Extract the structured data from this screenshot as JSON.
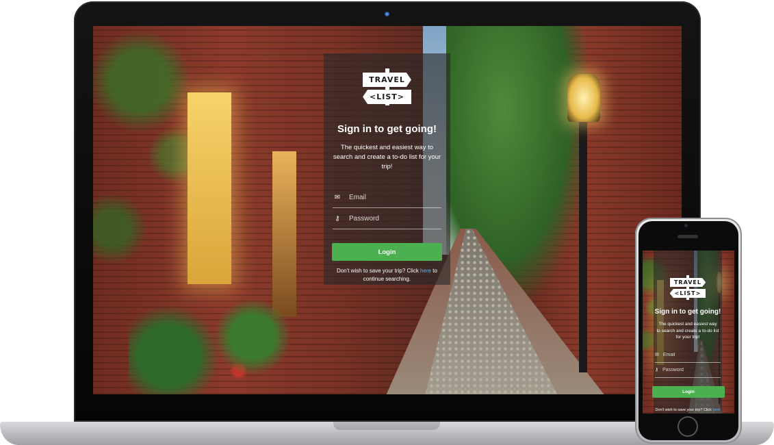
{
  "brand": {
    "logo_line_1": "TRAVEL",
    "logo_line_2": "<LIST>"
  },
  "login": {
    "title": "Sign in to get going!",
    "subtitle": "The quickest and easiest way to search and create a to-do list for your trip!",
    "email_placeholder": "Email",
    "password_placeholder": "Password",
    "login_label": "Login",
    "note_prefix": "Don't wish to save your trip? Click ",
    "note_link": "here",
    "note_suffix": " to continue searching."
  },
  "icons": {
    "email": "envelope-icon",
    "password": "key-icon"
  },
  "colors": {
    "login_button": "#4caf50",
    "link": "#5db8ff",
    "panel_overlay": "rgba(40,40,40,0.62)"
  }
}
